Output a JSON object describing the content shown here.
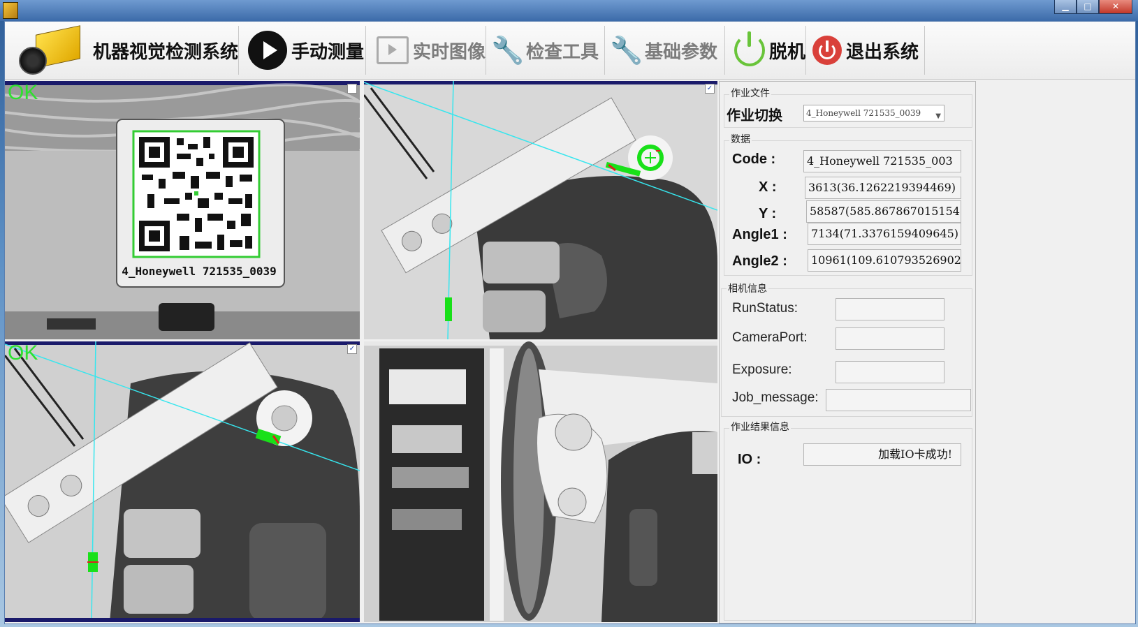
{
  "toolbar": {
    "brand_label": "机器视觉检测系统",
    "manual_measure": "手动测量",
    "realtime_image": "实时图像",
    "inspect_tool": "检查工具",
    "basic_params": "基础参数",
    "offline": "脱机",
    "exit_system": "退出系统"
  },
  "views": {
    "top_left_status": "OK",
    "bottom_left_status": "OK",
    "qr_caption": "4_Honeywell 721535_0039"
  },
  "panel": {
    "job_file_group": "作业文件",
    "job_switch_label": "作业切换",
    "job_switch_value": "4_Honeywell 721535_0039",
    "data_group": "数据",
    "code_label": "Code :",
    "code_value": "4_Honeywell 721535_003",
    "x_label": "X :",
    "x_value": "3613(36.1262219394469)",
    "y_label": "Y :",
    "y_value": "58587(585.867867015154",
    "angle1_label": "Angle1 :",
    "angle1_value": "7134(71.3376159409645)",
    "angle2_label": "Angle2 :",
    "angle2_value": "10961(109.610793526902",
    "camera_group": "相机信息",
    "runstatus_label": "RunStatus:",
    "cameraport_label": "CameraPort:",
    "exposure_label": "Exposure:",
    "jobmessage_label": "Job_message:",
    "result_group": "作业结果信息",
    "io_label": "IO :",
    "io_value": "加载IO卡成功!"
  },
  "colors": {
    "ok_green": "#2ee02e",
    "guide_cyan": "#36e6ee",
    "exit_red": "#d9403a",
    "offline_green": "#69c43a"
  }
}
